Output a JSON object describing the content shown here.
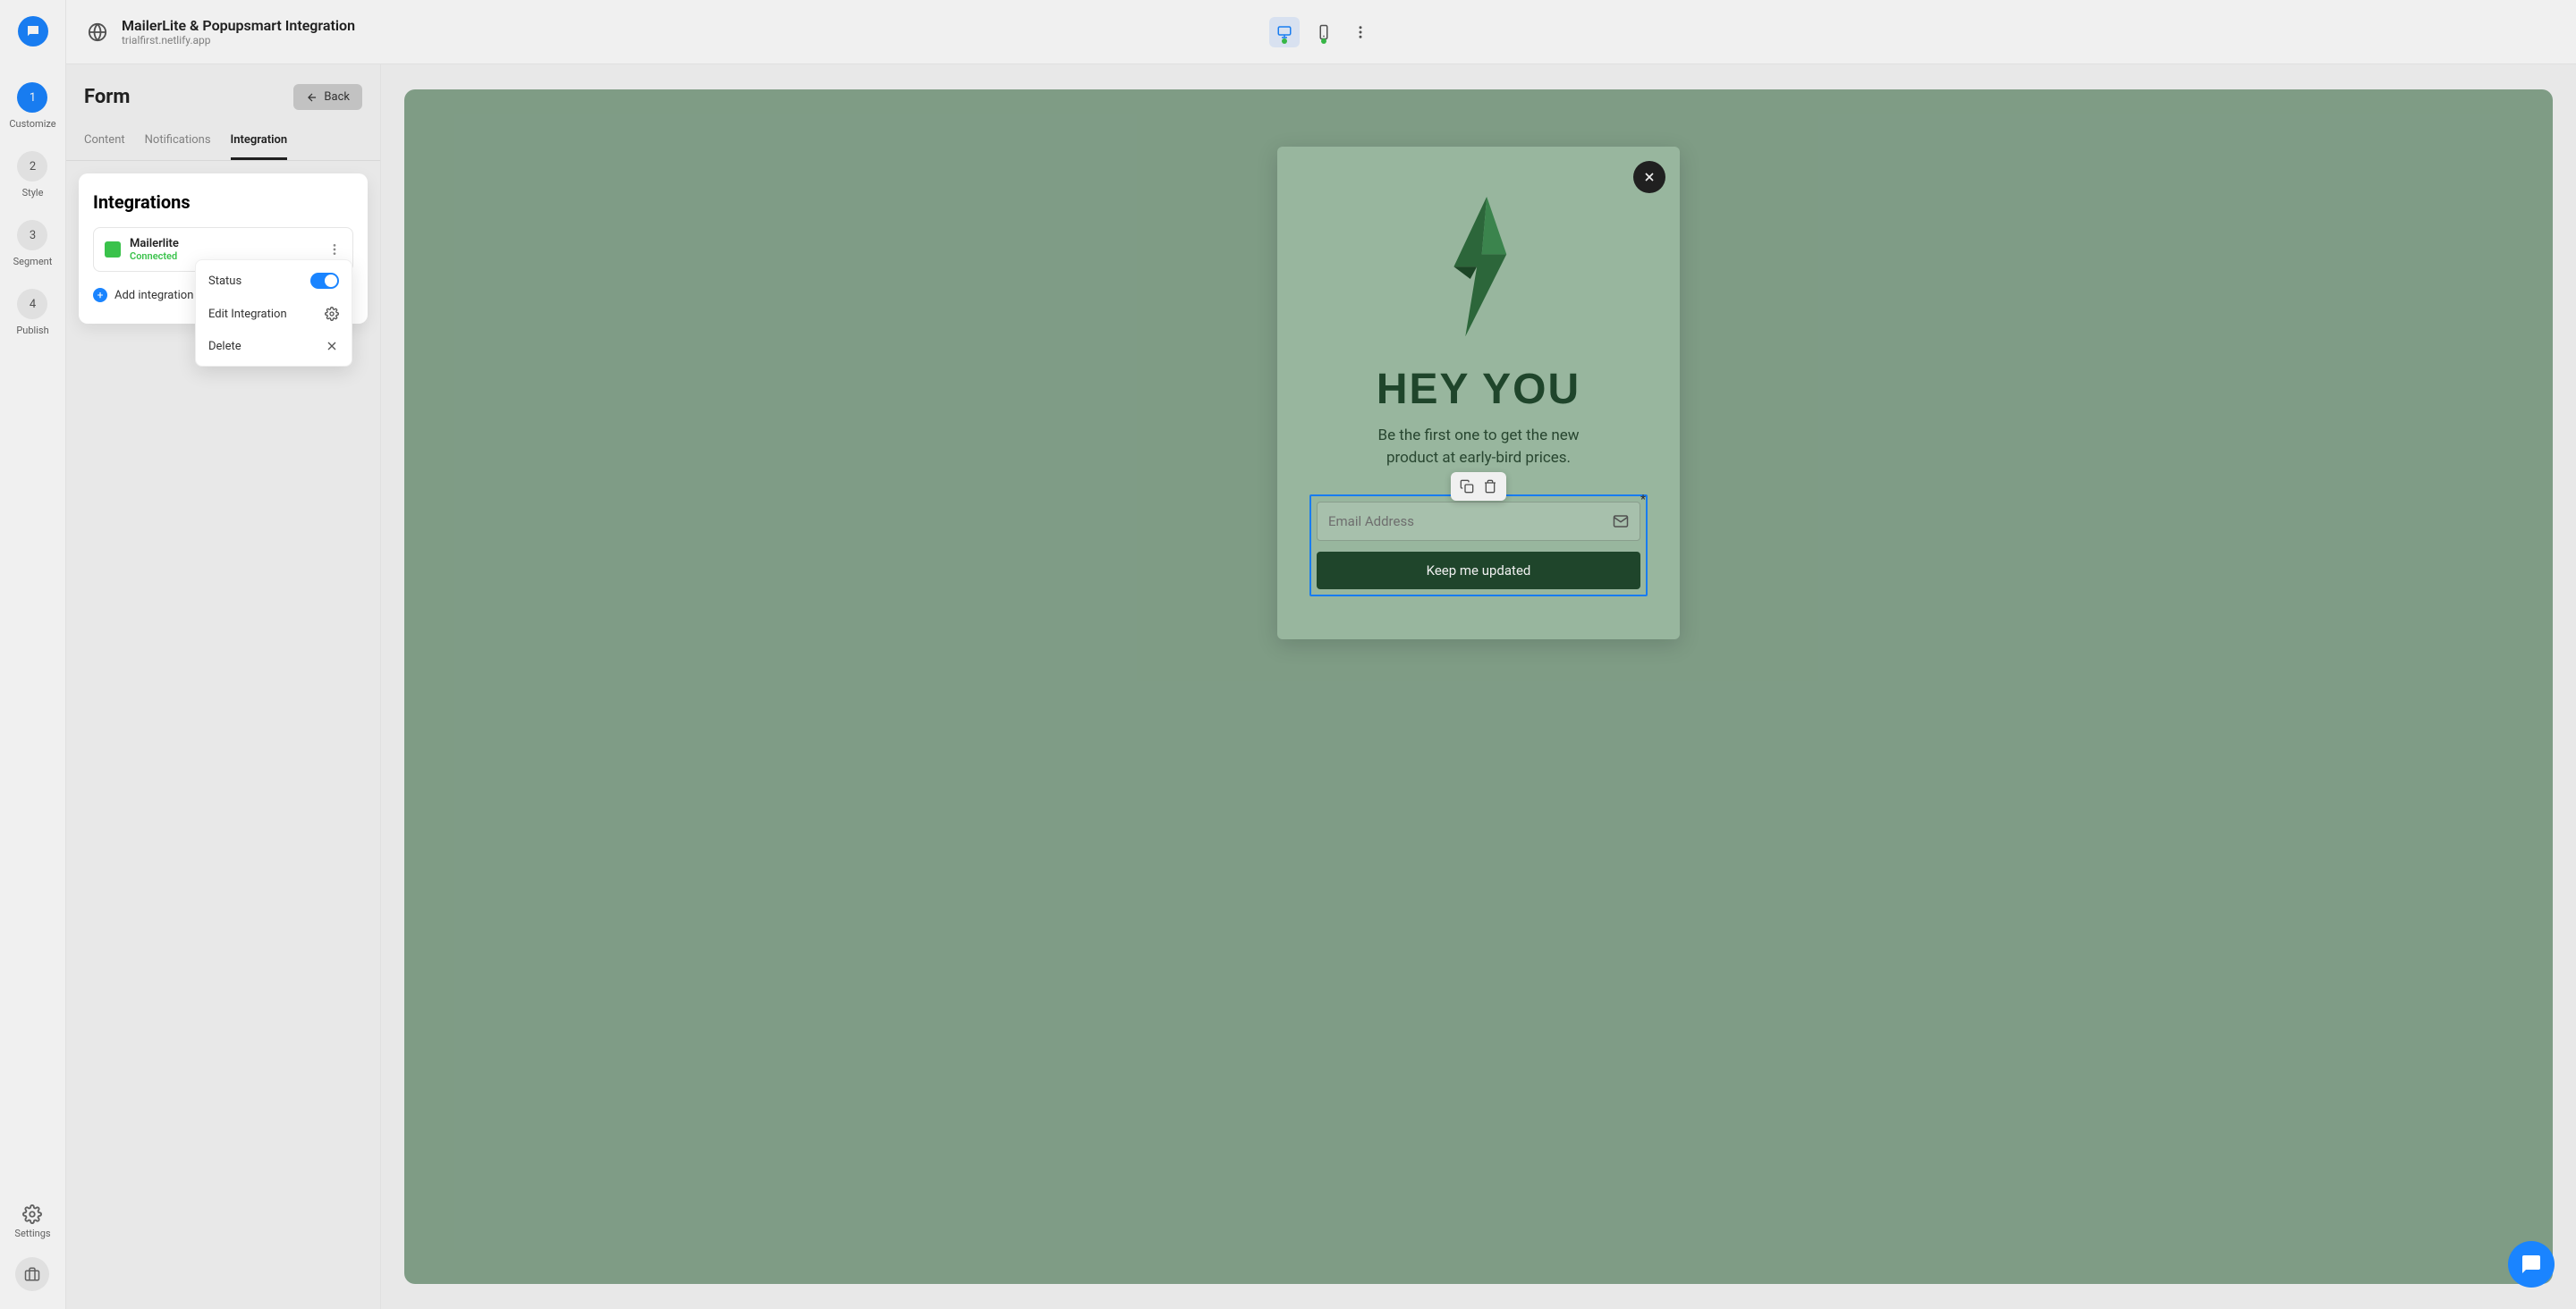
{
  "header": {
    "title": "MailerLite & Popupsmart Integration",
    "subtitle": "trialfirst.netlify.app"
  },
  "rail": {
    "steps": [
      {
        "num": "1",
        "label": "Customize",
        "active": true
      },
      {
        "num": "2",
        "label": "Style",
        "active": false
      },
      {
        "num": "3",
        "label": "Segment",
        "active": false
      },
      {
        "num": "4",
        "label": "Publish",
        "active": false
      }
    ],
    "settings_label": "Settings"
  },
  "panel": {
    "title": "Form",
    "back_label": "Back",
    "tabs": [
      {
        "label": "Content",
        "active": false
      },
      {
        "label": "Notifications",
        "active": false
      },
      {
        "label": "Integration",
        "active": true
      }
    ]
  },
  "integrations": {
    "heading": "Integrations",
    "item": {
      "name": "Mailerlite",
      "status": "Connected"
    },
    "add_label": "Add integration"
  },
  "context_menu": {
    "status_label": "Status",
    "status_on": true,
    "edit_label": "Edit Integration",
    "delete_label": "Delete"
  },
  "popup": {
    "heading": "HEY YOU",
    "body_line1": "Be the first one to get the new",
    "body_line2": "product at early-bird prices.",
    "email_placeholder": "Email Address",
    "required_mark": "*",
    "cta_label": "Keep me updated"
  },
  "colors": {
    "accent": "#1a84ff",
    "popup_bg": "#a2c2a8",
    "canvas_bg": "#87a68e",
    "popup_dark": "#214a2e",
    "connected": "#3ac24b"
  }
}
